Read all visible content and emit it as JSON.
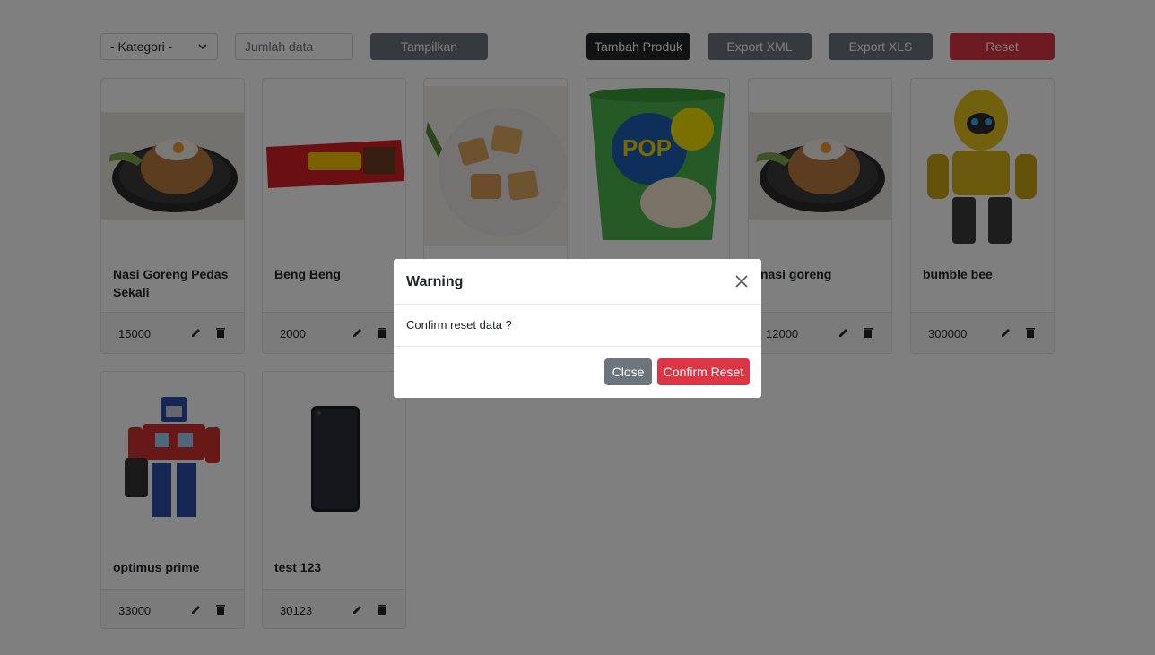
{
  "toolbar": {
    "category_select": "- Kategori -",
    "count_placeholder": "Jumlah data",
    "show_button": "Tampilkan",
    "add_button": "Tambah Produk",
    "export_xml_button": "Export XML",
    "export_xls_button": "Export XLS",
    "reset_button": "Reset"
  },
  "products": [
    {
      "name": "Nasi Goreng Pedas Sekali",
      "price": "15000",
      "image": "fried-rice-image"
    },
    {
      "name": "Beng Beng",
      "price": "2000",
      "image": "beng-beng-snack-image"
    },
    {
      "name": "",
      "price": "",
      "image": "fried-tofu-image"
    },
    {
      "name": "",
      "price": "",
      "image": "pop-mie-cup-image"
    },
    {
      "name": "nasi goreng",
      "price": "12000",
      "image": "fried-rice-image"
    },
    {
      "name": "bumble bee",
      "price": "300000",
      "image": "bumblebee-robot-image"
    },
    {
      "name": "optimus prime",
      "price": "33000",
      "image": "optimus-prime-robot-image"
    },
    {
      "name": "test 123",
      "price": "30123",
      "image": "smartphone-image"
    }
  ],
  "modal": {
    "title": "Warning",
    "body": "Confirm reset data ?",
    "close_button": "Close",
    "confirm_button": "Confirm Reset"
  },
  "colors": {
    "danger": "#dc3545",
    "secondary": "#6c757d",
    "dark": "#212529",
    "backdrop": "rgba(0,0,0,0.5)"
  }
}
